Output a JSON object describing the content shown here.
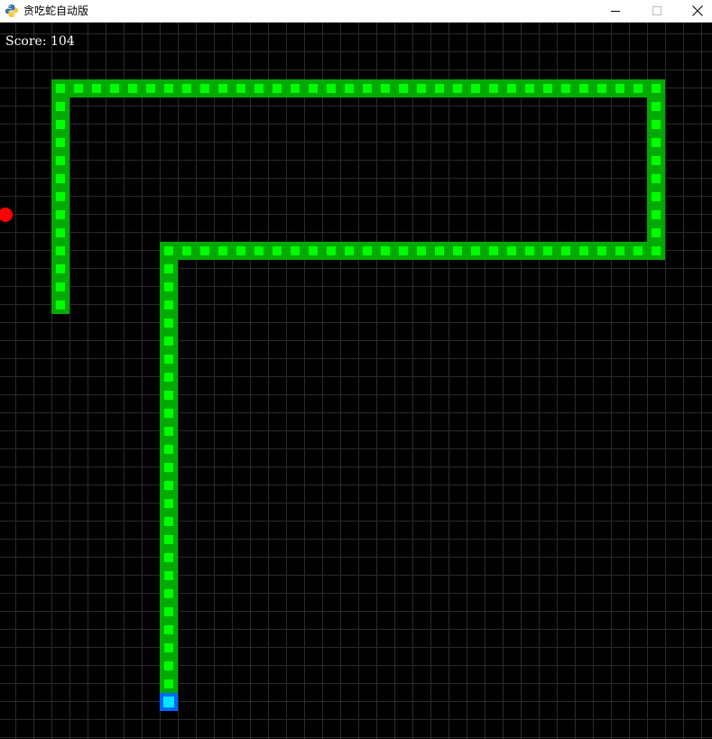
{
  "window": {
    "title": "贪吃蛇自动版",
    "app_icon": "python-icon",
    "controls": [
      "minimize-icon",
      "maximize-icon",
      "close-icon"
    ]
  },
  "game": {
    "score_text": "Score: 104",
    "grid_color": "#2a2a2a",
    "background_color": "#000000",
    "snake_body_color": "#00aa00",
    "snake_body_inner_color": "#00ff00",
    "snake_head_border_color": "#0066ff",
    "snake_head_color": "#00e5ff",
    "food_color": "#ff0000"
  }
}
